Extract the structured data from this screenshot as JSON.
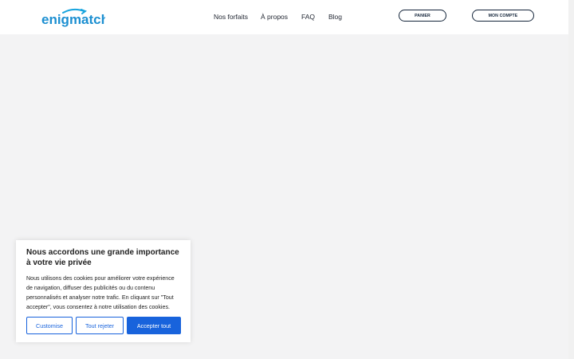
{
  "header": {
    "logo_text": "enigmatch.",
    "nav": [
      "Nos forfaits",
      "À propos",
      "FAQ",
      "Blog"
    ],
    "panier_label": "PANIER",
    "compte_label": "MON COMPTE"
  },
  "cookie": {
    "title": "Nous accordons une grande importance à votre vie privée",
    "text": "Nous utilisons des cookies pour améliorer votre expérience de navigation, diffuser des publicités ou du contenu personnalisés et analyser notre trafic. En cliquant sur \"Tout accepter\", vous consentez à notre utilisation des cookies.",
    "customise_label": "Customise",
    "reject_label": "Tout rejeter",
    "accept_label": "Accepter tout"
  },
  "colors": {
    "brand": "#1c8fd1",
    "accent": "#1863dc",
    "navy": "#14253a",
    "background": "#f3f3f4"
  }
}
